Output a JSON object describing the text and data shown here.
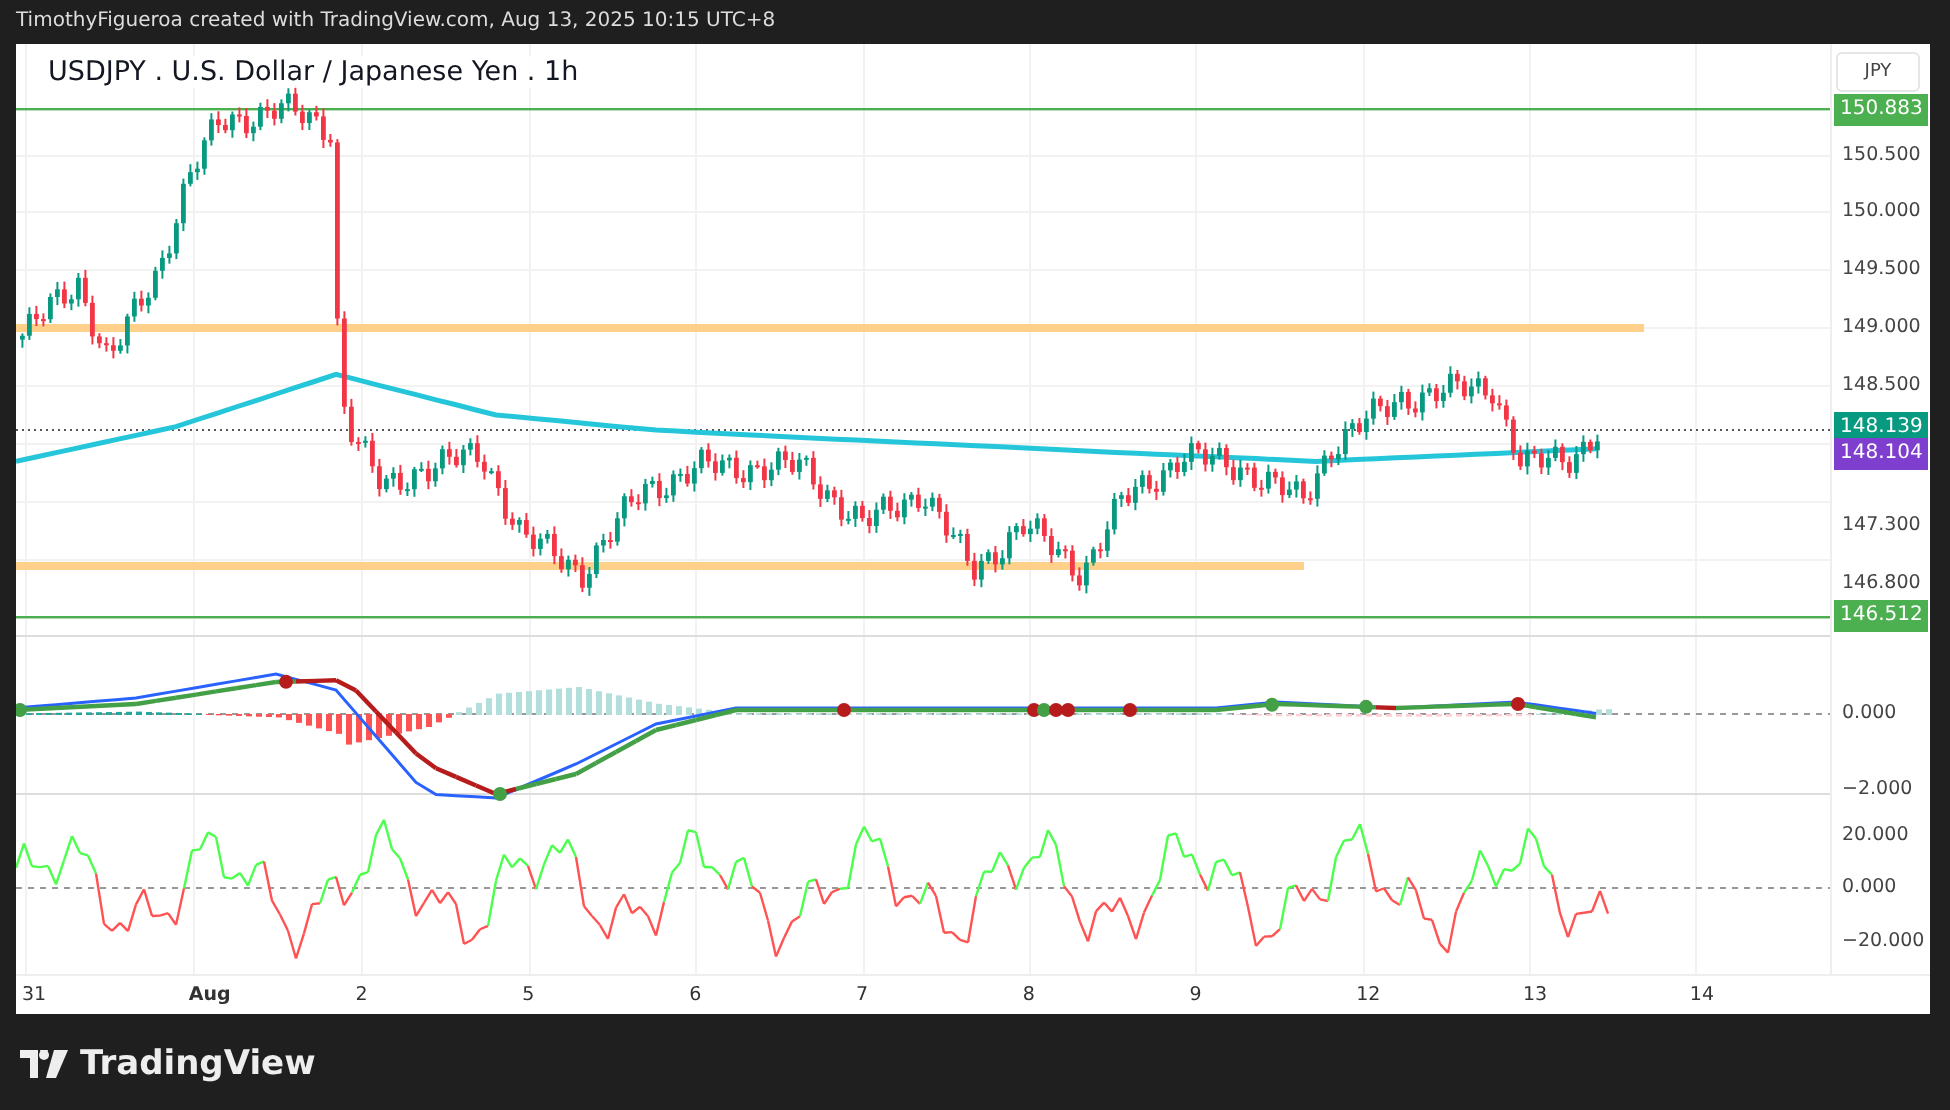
{
  "header": {
    "caption": "TimothyFigueroa created with TradingView.com, Aug 13, 2025 10:15 UTC+8"
  },
  "chart": {
    "title": "USDJPY . U.S. Dollar / Japanese Yen . 1h",
    "currency": "JPY",
    "price_axis": [
      "150.500",
      "150.000",
      "149.500",
      "149.000",
      "148.500",
      "147.300",
      "146.800"
    ],
    "price_badges": [
      {
        "label": "150.883",
        "color": "#4caf50"
      },
      {
        "label": "148.139",
        "color": "#089981"
      },
      {
        "label": "148.104",
        "color": "#7e3fcf"
      },
      {
        "label": "146.512",
        "color": "#4caf50"
      }
    ],
    "macd_axis": [
      "0.000",
      "−2.000"
    ],
    "oscillator_axis": [
      "20.000",
      "0.000",
      "−20.000"
    ],
    "time_axis": [
      {
        "label": "31",
        "kind": "day"
      },
      {
        "label": "Aug",
        "kind": "month"
      },
      {
        "label": "2",
        "kind": "day"
      },
      {
        "label": "5",
        "kind": "day"
      },
      {
        "label": "6",
        "kind": "day"
      },
      {
        "label": "7",
        "kind": "day"
      },
      {
        "label": "8",
        "kind": "day"
      },
      {
        "label": "9",
        "kind": "day"
      },
      {
        "label": "12",
        "kind": "day"
      },
      {
        "label": "13",
        "kind": "day"
      },
      {
        "label": "14",
        "kind": "day"
      }
    ]
  },
  "footer": {
    "logo_text": "TradingView"
  }
}
